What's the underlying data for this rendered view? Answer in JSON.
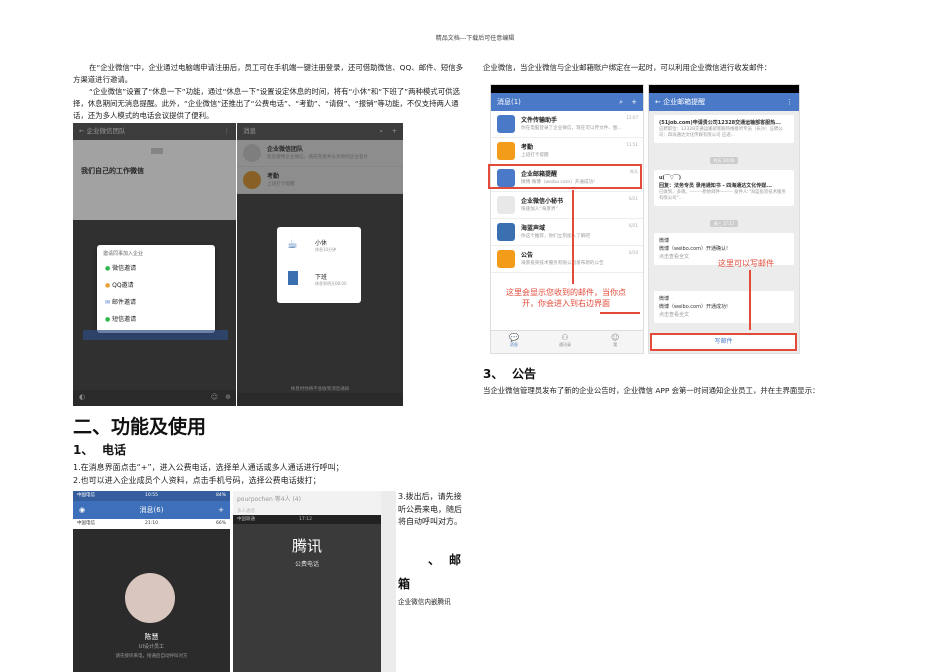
{
  "header": {
    "text": "精品文档---下载后可任意编辑"
  },
  "left": {
    "p1": "在“企业微信”中，企业通过电脑端申请注册后，员工可在手机端一键注册登录，还可借助微信、QQ、邮件、短信多方渠道进行邀请。",
    "p2": "“企业微信”设置了“休息一下”功能，通过“休息一下”设置设定休息的时间，将有“小休”和“下班了”两种模式可供选择，休息期间无消息提醒。此外，“企业微信”还推出了“公费电话”、“考勤”、“请假”、“报销”等功能，不仅支持两人通话，还为多人模式的电话会议提供了便利。",
    "shot1": {
      "title": "企业微信团队",
      "group": "我们自己的工作微信",
      "dialog_title": "邀请同事加入企业",
      "options": [
        "微信邀请",
        "QQ邀请",
        "邮件邀请",
        "短信邀请"
      ]
    },
    "shot2": {
      "title": "消息",
      "row1_title": "企业微信团队",
      "row1_sub": "欢迎使用企业微信，请先完善并分享你的企业名片",
      "row2_title": "考勤",
      "row2_sub": "上班打卡提醒",
      "opt1": "小休",
      "opt1_sub": "休息10分钟",
      "opt2": "下班",
      "opt2_sub": "休息到明天08:00",
      "footer": "休息时你将不会收到消息通知"
    },
    "section_title": "二、功能及使用",
    "sub_num": "1、",
    "sub_title": "电话",
    "steps": [
      "1.在消息界面点击“+”，进入公费电话，选择单人通话或多人通话进行呼叫；",
      "2.也可以进入企业成员个人资料，点击手机号码，选择公费电话拨打；"
    ],
    "shot3": {
      "status": "中国电信",
      "time": "10:55",
      "battery": "84%",
      "title": "消息(6)",
      "inner_status": "中国电信",
      "inner_time": "21:10",
      "inner_battery": "66%",
      "name": "陈慧",
      "role": "UI设计员工",
      "hint": "请先接听来电，接通后自动呼叫对方"
    },
    "shot4": {
      "top": "pourpochen 等4人 (4)",
      "sub": "多人通话",
      "status": "中国联通",
      "time": "17:12",
      "brand": "腾讯",
      "label": "公费电话"
    },
    "step3": "3.拨出后，请先接听公费来电，随后将自动呼叫对方。",
    "mail_num": "、",
    "mail_title_a": "邮",
    "mail_title_b": "箱",
    "mail_desc": "企业微信内嵌腾讯"
  },
  "right": {
    "intro": "企业微信，当企业微信与企业邮箱账户绑定在一起时，可以利用企业微信进行收发邮件：",
    "shot5": {
      "title": "消息(1)",
      "rows": [
        {
          "title": "文件传输助手",
          "sub": "你在电脑登录了企业微信，现在可以传文件、图...",
          "time": "12:07",
          "color": "#4a79c8"
        },
        {
          "title": "考勤",
          "sub": "上班打卡提醒",
          "time": "11:51",
          "color": "#f39c1a"
        },
        {
          "title": "企业邮箱提醒",
          "sub": "微博 微博（weibo.com）开通成功!",
          "time": "昨天",
          "color": "#4a79c8"
        },
        {
          "title": "企业微信小秘书",
          "sub": "快速加入“海景界”",
          "time": "6/21",
          "color": "#e8e8e8"
        },
        {
          "title": "海蓝声域",
          "sub": "你这个推荐，你们立刻加入了解吧",
          "time": "6/21",
          "color": "#3a6fb0"
        },
        {
          "title": "公告",
          "sub": "海景投资技术服务有限公司发布新的公告",
          "time": "6/20",
          "color": "#f39c1a"
        }
      ],
      "note": "这里会显示您收到的邮件，当你点开，你会进入到右边界面",
      "tabs": [
        "消息",
        "通讯录",
        "我"
      ]
    },
    "shot6": {
      "title": "企业邮箱提醒",
      "card1": "(51job.com)申请贵公司12328交通运输部客服热...",
      "card1_sub": "应聘职位：12328交通运输部客服热线接听专员（长沙）应聘公司：四海通达文化传媒有限公司 应递...",
      "chip1": "昨天 10:00",
      "card2_title": "u(￣▽￣)",
      "card2": "回复：法务专员 录用通知书 - 四海通达文化传媒...",
      "card2_sub": "已收到，多谢。--------原始邮件-------- 发件人:\"海蓝投资技术服务有限公司\"...",
      "chip2": "周三 17:17",
      "card3_title": "微博",
      "card3": "微博（weibo.com）开通确认!",
      "card3_sub": "点击查看全文",
      "note": "这里可以写邮件",
      "card4_title": "微博",
      "card4": "微博（weibo.com）开通成功!",
      "card4_sub": "点击查看全文",
      "write": "写邮件"
    },
    "section_num": "3、",
    "section_title": "公告",
    "desc": "当企业微信管理员发布了新的企业公告时，企业微信 APP 会第一时间通知企业员工，并在主界面显示："
  }
}
